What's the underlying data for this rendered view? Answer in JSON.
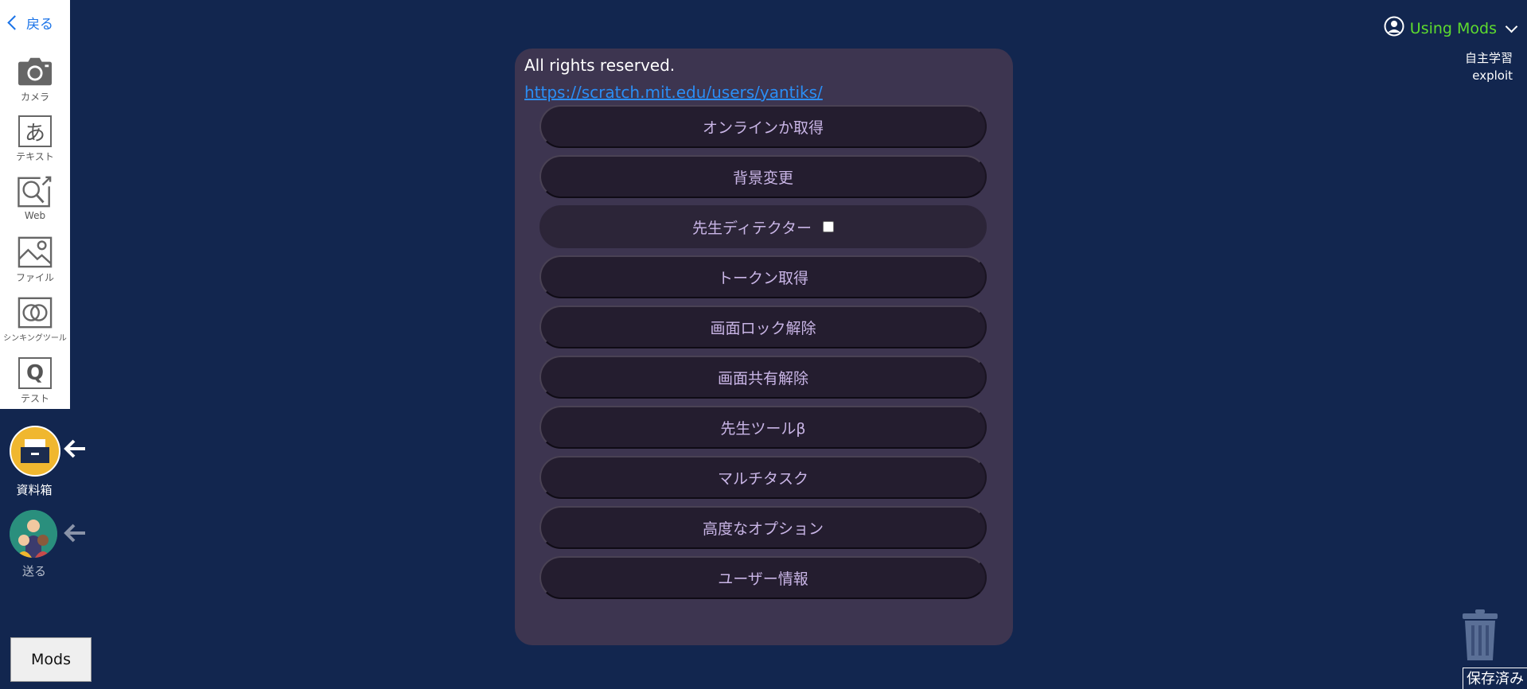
{
  "toolbar": {
    "back_label": "戻る",
    "tools": [
      {
        "label": "カメラ",
        "icon": "camera-icon"
      },
      {
        "label": "テキスト",
        "icon": "hiragana-a-icon",
        "glyph": "あ"
      },
      {
        "label": "Web",
        "icon": "web-search-icon"
      },
      {
        "label": "ファイル",
        "icon": "image-file-icon"
      },
      {
        "label": "シンキングツール",
        "icon": "venn-diagram-icon"
      },
      {
        "label": "テスト",
        "icon": "test-q-icon",
        "glyph": "Q"
      }
    ]
  },
  "side": {
    "materials_label": "資料箱",
    "send_label": "送る"
  },
  "mods_button_label": "Mods",
  "header": {
    "using_mods_label": "Using Mods",
    "line1": "自主学習",
    "line2": "exploit"
  },
  "panel": {
    "rights": "All rights reserved.",
    "link": "https://scratch.mit.edu/users/yantiks/",
    "buttons": [
      {
        "label": "オンラインか取得"
      },
      {
        "label": "背景変更"
      },
      {
        "label": "先生ディテクター",
        "checkbox": false
      },
      {
        "label": "トークン取得"
      },
      {
        "label": "画面ロック解除"
      },
      {
        "label": "画面共有解除"
      },
      {
        "label": "先生ツールβ"
      },
      {
        "label": "マルチタスク"
      },
      {
        "label": "高度なオプション"
      },
      {
        "label": "ユーザー情報"
      }
    ]
  },
  "saved_label": "保存済み",
  "colors": {
    "background": "#12264f",
    "panel": "#3d3550",
    "button": "#241d2f",
    "button_text": "#c9b5e6",
    "accent_green": "#5edc2e",
    "link": "#2b8ef5",
    "materials_circle": "#f0b72f"
  }
}
